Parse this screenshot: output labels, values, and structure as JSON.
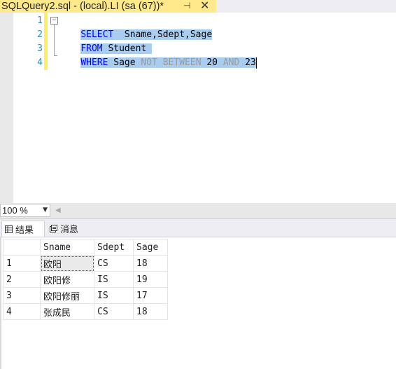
{
  "tab": {
    "title": "SQLQuery2.sql - (local).LI (sa (67))*",
    "pin_glyph": "⊣",
    "close_glyph": "✕"
  },
  "editor": {
    "line_numbers": [
      "1",
      "2",
      "3",
      "4"
    ],
    "fold_glyph": "−",
    "lines": [
      {
        "kw": "SELECT",
        "rest": "  Sname,Sdept,Sage"
      },
      {
        "kw": "FROM",
        "rest": " Student"
      },
      {
        "kw": "WHERE",
        "rest": " Sage ",
        "gray": "NOT BETWEEN",
        "num1": " 20 ",
        "kw2": "AND",
        "num2": " 23"
      }
    ]
  },
  "zoom": {
    "value": "100 %",
    "arrow": "▼",
    "scroll_left": "◀"
  },
  "results": {
    "tabs": [
      {
        "label": "结果",
        "icon": "grid-icon",
        "active": true
      },
      {
        "label": "消息",
        "icon": "message-icon",
        "active": false
      }
    ],
    "columns": [
      "Sname",
      "Sdept",
      "Sage"
    ],
    "rows": [
      {
        "num": "1",
        "cells": [
          "欧阳",
          "CS",
          "18"
        ]
      },
      {
        "num": "2",
        "cells": [
          "欧阳修",
          "IS",
          "19"
        ]
      },
      {
        "num": "3",
        "cells": [
          "欧阳修丽",
          "IS",
          "17"
        ]
      },
      {
        "num": "4",
        "cells": [
          "张成民",
          "CS",
          "18"
        ]
      }
    ]
  },
  "colors": {
    "tab_active": "#ffe98b",
    "keyword": "#0000ff",
    "line_number": "#2b91af",
    "selection": "#a9cdf1",
    "margin_bar": "#ffee62"
  }
}
